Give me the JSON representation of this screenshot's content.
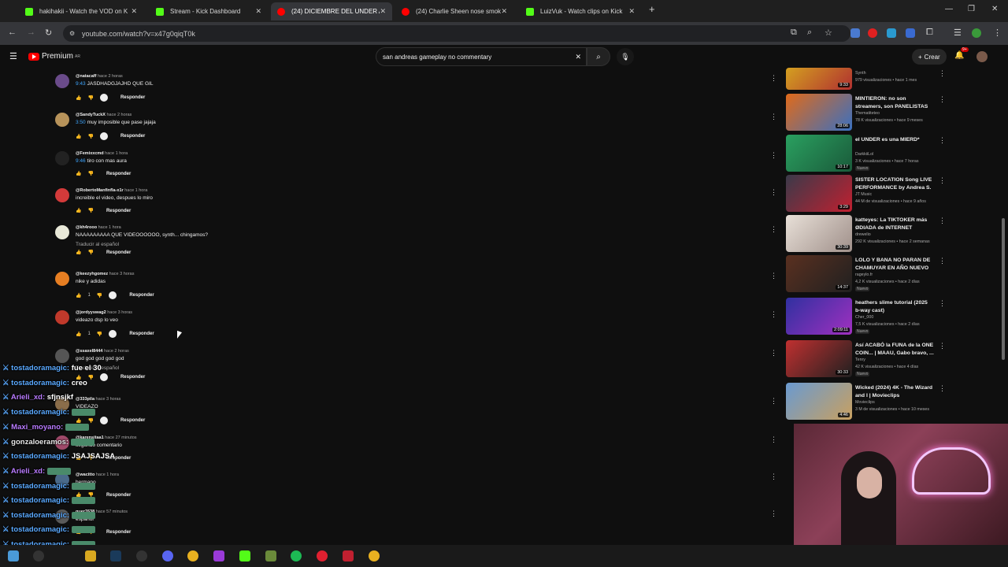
{
  "browser": {
    "tabs": [
      {
        "title": "hakihakii - Watch the VOD on K",
        "favicon_color": "#53fc18",
        "active": false
      },
      {
        "title": "Stream - Kick Dashboard",
        "favicon_color": "#53fc18",
        "active": false
      },
      {
        "title": "(24) DICIEMBRE DEL UNDER AR",
        "favicon_color": "#ff0000",
        "active": true
      },
      {
        "title": "(24) Charlie Sheen nose smokin",
        "favicon_color": "#ff0000",
        "active": false
      },
      {
        "title": "LuizVuk - Watch clips on Kick",
        "favicon_color": "#53fc18",
        "active": false
      }
    ],
    "new_tab": "+",
    "url": "youtube.com/watch?v=x47g0qiqT0k",
    "window_controls": {
      "minimize": "—",
      "restore": "❐",
      "close": "✕"
    }
  },
  "youtube": {
    "logo_text": "Premium",
    "logo_region": "AR",
    "search_value": "san andreas gameplay no commentary",
    "create_label": "Crear",
    "notification_count": "9+"
  },
  "comments": [
    {
      "author": "@natacaff",
      "time": "hace 2 horas",
      "timestamp": "9:43",
      "text": "JASDHADGJAJHD QUE GIL",
      "likes": "",
      "heart": true,
      "reply": "Responder",
      "avatar_color": "#6a4b8a"
    },
    {
      "author": "@SandyTuckX",
      "time": "hace 2 horas",
      "timestamp": "3:50",
      "text": "muy imposible que pase jajaja",
      "likes": "",
      "heart": true,
      "reply": "Responder",
      "avatar_color": "#b7935a"
    },
    {
      "author": "@Femixxcmd",
      "time": "hace 1 hora",
      "timestamp": "9:46",
      "text": "tiro con mas aura",
      "likes": "",
      "heart": false,
      "reply": "Responder",
      "avatar_color": "#222222"
    },
    {
      "author": "@RobertoManfinfla-x1r",
      "time": "hace 1 hora",
      "timestamp": "",
      "text": "increible el video, despues lo miro",
      "likes": "",
      "heart": false,
      "reply": "Responder",
      "avatar_color": "#d33a3a"
    },
    {
      "author": "@kh4rooo",
      "time": "hace 1 hora",
      "timestamp": "",
      "text": "NAAAAAAAAA QUE VIDEOOOOOO, synth... chingamos?",
      "translate": "Traducir al español",
      "likes": "",
      "heart": false,
      "reply": "Responder",
      "avatar_color": "#e8e8d8"
    },
    {
      "author": "@keezyhgomez",
      "time": "hace 3 horas",
      "timestamp": "",
      "text": "nike y adidas",
      "likes": "1",
      "heart": true,
      "reply": "Responder",
      "avatar_color": "#e67e22"
    },
    {
      "author": "@jordyyswag2",
      "time": "hace 3 horas",
      "timestamp": "",
      "text": "videazo dsp lo veo",
      "likes": "1",
      "heart": true,
      "reply": "Responder",
      "avatar_color": "#c0392b"
    },
    {
      "author": "@ssaxel8444",
      "time": "hace 2 horas",
      "timestamp": "",
      "text": "god god god god god",
      "translate": "Traducir al español",
      "likes": "",
      "heart": true,
      "reply": "Responder",
      "avatar_color": "#555555"
    },
    {
      "author": "@333pila",
      "time": "hace 3 horas",
      "timestamp": "",
      "text": "VIDEAZO",
      "likes": "",
      "heart": true,
      "reply": "Responder",
      "avatar_color": "#8a6d4a"
    },
    {
      "author": "@karensitaa1",
      "time": "hace 27 minutos",
      "timestamp": "",
      "text": "segundo comentario",
      "likes": "",
      "heart": false,
      "reply": "Responder",
      "avatar_color": "#a04a6a"
    },
    {
      "author": "@wacitto",
      "time": "hace 1 hora",
      "timestamp": "",
      "text": "hermano",
      "likes": "",
      "heart": false,
      "reply": "Responder",
      "avatar_color": "#4a6a8a"
    },
    {
      "author": "guer7638",
      "time": "hace 57 minutos",
      "timestamp": "",
      "text": "español",
      "likes": "",
      "heart": false,
      "reply": "Responder",
      "avatar_color": "#5a5a5a"
    }
  ],
  "chat": [
    {
      "user": "tostadoramagic:",
      "msg": "fue el 30",
      "color": "blue"
    },
    {
      "user": "tostadoramagic:",
      "msg": "creo",
      "color": "blue"
    },
    {
      "user": "Arieli_xd:",
      "msg": "sfjnsjkf",
      "color": "purple"
    },
    {
      "user": "tostadoramagic:",
      "msg": "",
      "color": "blue"
    },
    {
      "user": "Maxi_moyano:",
      "msg": "",
      "color": "purple"
    },
    {
      "user": "gonzaloeramos:",
      "msg": "",
      "color": "white"
    },
    {
      "user": "tostadoramagic:",
      "msg": "JSAJSAJSA",
      "color": "blue"
    },
    {
      "user": "Arieli_xd:",
      "msg": "",
      "color": "purple"
    },
    {
      "user": "tostadoramagic:",
      "msg": "",
      "color": "blue"
    },
    {
      "user": "tostadoramagic:",
      "msg": "",
      "color": "blue"
    },
    {
      "user": "tostadoramagic:",
      "msg": "",
      "color": "blue"
    },
    {
      "user": "tostadoramagic:",
      "msg": "",
      "color": "blue"
    },
    {
      "user": "tostadoramagic:",
      "msg": "",
      "color": "blue"
    },
    {
      "user": "tostadoramagic:",
      "msg": "",
      "color": "blue"
    }
  ],
  "recommendations": [
    {
      "title": "",
      "channel": "Synth",
      "views": "979 visualizaciones • hace 1 mes",
      "duration": "9:33",
      "badge": "",
      "thumb": [
        "#d4a020",
        "#b03030"
      ]
    },
    {
      "title": "MINTIERON: no son streamers, son PANELISTAS con sponsor",
      "channel": "Thematiteteo",
      "views": "78 K visualizaciones • hace 9 meses",
      "duration": "28:06",
      "badge": "",
      "thumb": [
        "#e06a1a",
        "#3a70c0"
      ]
    },
    {
      "title": "el UNDER es una MIERD*",
      "channel": "DarkkiiLol",
      "views": "3 K visualizaciones • hace 7 horas",
      "duration": "10:17",
      "badge": "Nuevo",
      "thumb": [
        "#2aa060",
        "#1a5a3a"
      ]
    },
    {
      "title": "SISTER LOCATION Song LIVE PERFORMANCE by Andrea S. ...",
      "channel": "JT Music",
      "views": "44 M de visualizaciones • hace 9 años",
      "duration": "3:29",
      "badge": "",
      "thumb": [
        "#3a3a4a",
        "#c02030"
      ]
    },
    {
      "title": "katteyes: La TIKTOKER más ØDIADA de INTERNET",
      "channel": "drewelio",
      "views": "292 K visualizaciones • hace 2 semanas",
      "duration": "30:39",
      "badge": "",
      "thumb": [
        "#e8e0d8",
        "#a0908a"
      ]
    },
    {
      "title": "LOLO Y BANA NO PARAN DE CHAMUYAR EN AÑO NUEVO",
      "channel": "rageylo.fr",
      "views": "4,2 K visualizaciones • hace 2 días",
      "duration": "14:37",
      "badge": "Nuevo",
      "thumb": [
        "#5a3020",
        "#202020"
      ]
    },
    {
      "title": "heathers slime tutorial (2025 b-way cast)",
      "channel": "Cher_000",
      "views": "7,5 K visualizaciones • hace 2 días",
      "duration": "2:09:11",
      "badge": "Nuevo",
      "thumb": [
        "#3030a0",
        "#a030c0"
      ]
    },
    {
      "title": "Así ACABÓ la FUNA de la ONE COIN... | MAAU, Gabo bravo, ...",
      "channel": "Tenry",
      "views": "42 K visualizaciones • hace 4 días",
      "duration": "30:33",
      "badge": "Nuevo",
      "thumb": [
        "#c03030",
        "#202020"
      ]
    },
    {
      "title": "Wicked (2024) 4K - The Wizard and I | Movieclips",
      "channel": "Movieclips",
      "views": "3 M de visualizaciones • hace 10 meses",
      "duration": "4:46",
      "badge": "",
      "thumb": [
        "#6a9ad0",
        "#c8a060"
      ]
    }
  ],
  "colors": {
    "bg": "#0f0f0f",
    "accent": "#ff0000",
    "link": "#3ea6ff",
    "chat_blue": "#5aa9ff",
    "chat_purple": "#b97bff"
  }
}
